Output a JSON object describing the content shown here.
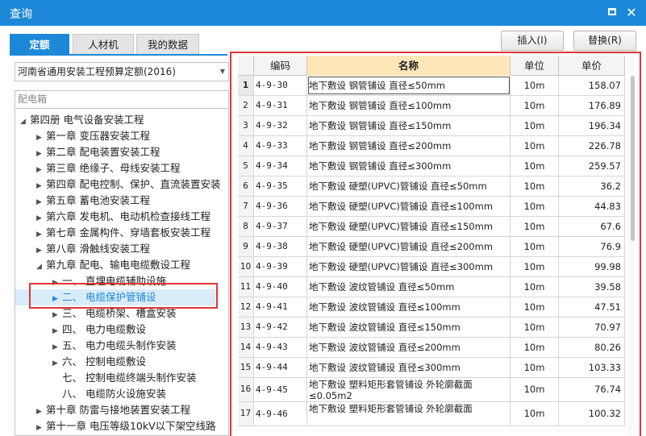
{
  "window": {
    "title": "查询"
  },
  "tabs": [
    {
      "label": "定额"
    },
    {
      "label": "人材机"
    },
    {
      "label": "我的数据"
    }
  ],
  "actions": {
    "insert_label": "插入(I)",
    "replace_label": "替换(R)"
  },
  "library": {
    "selected": "河南省通用安装工程预算定额(2016)"
  },
  "search": {
    "placeholder": "配电箱"
  },
  "tree": [
    {
      "label": "第四册 电气设备安装工程"
    },
    {
      "label": "第一章 变压器安装工程"
    },
    {
      "label": "第二章 配电装置安装工程"
    },
    {
      "label": "第三章 绝缘子、母线安装工程"
    },
    {
      "label": "第四章 配电控制、保护、直流装置安装"
    },
    {
      "label": "第五章 蓄电池安装工程"
    },
    {
      "label": "第六章 发电机、电动机检查接线工程"
    },
    {
      "label": "第七章 金属构件、穿墙套板安装工程"
    },
    {
      "label": "第八章 滑触线安装工程"
    },
    {
      "label": "第九章 配电、输电电缆敷设工程"
    },
    {
      "label": "一、 直埋电缆辅助设施"
    },
    {
      "label": "二、 电缆保护管铺设"
    },
    {
      "label": "三、 电缆桥架、槽盒安装"
    },
    {
      "label": "四、 电力电缆敷设"
    },
    {
      "label": "五、 电力电缆头制作安装"
    },
    {
      "label": "六、 控制电缆敷设"
    },
    {
      "label": "七、 控制电缆终端头制作安装"
    },
    {
      "label": "八、 电缆防火设施安装"
    },
    {
      "label": "第十章 防雷与接地装置安装工程"
    },
    {
      "label": "第十一章 电压等级10kV以下架空线路"
    }
  ],
  "grid": {
    "headers": {
      "code": "编码",
      "name": "名称",
      "unit": "单位",
      "price": "单价"
    },
    "rows": [
      {
        "idx": "1",
        "code": "4-9-30",
        "name": "地下敷设 钢管铺设 直径≤50mm",
        "unit": "10m",
        "price": "158.07"
      },
      {
        "idx": "2",
        "code": "4-9-31",
        "name": "地下敷设 钢管铺设 直径≤100mm",
        "unit": "10m",
        "price": "176.89"
      },
      {
        "idx": "3",
        "code": "4-9-32",
        "name": "地下敷设 钢管铺设 直径≤150mm",
        "unit": "10m",
        "price": "196.34"
      },
      {
        "idx": "4",
        "code": "4-9-33",
        "name": "地下敷设 钢管铺设 直径≤200mm",
        "unit": "10m",
        "price": "226.78"
      },
      {
        "idx": "5",
        "code": "4-9-34",
        "name": "地下敷设 钢管铺设 直径≤300mm",
        "unit": "10m",
        "price": "259.57"
      },
      {
        "idx": "6",
        "code": "4-9-35",
        "name": "地下敷设 硬塑(UPVC)管铺设 直径≤50mm",
        "unit": "10m",
        "price": "36.2"
      },
      {
        "idx": "7",
        "code": "4-9-36",
        "name": "地下敷设 硬塑(UPVC)管铺设 直径≤100mm",
        "unit": "10m",
        "price": "44.83"
      },
      {
        "idx": "8",
        "code": "4-9-37",
        "name": "地下敷设 硬塑(UPVC)管铺设 直径≤150mm",
        "unit": "10m",
        "price": "67.6"
      },
      {
        "idx": "9",
        "code": "4-9-38",
        "name": "地下敷设 硬塑(UPVC)管铺设 直径≤200mm",
        "unit": "10m",
        "price": "76.9"
      },
      {
        "idx": "10",
        "code": "4-9-39",
        "name": "地下敷设 硬塑(UPVC)管铺设 直径≤300mm",
        "unit": "10m",
        "price": "99.98"
      },
      {
        "idx": "11",
        "code": "4-9-40",
        "name": "地下敷设 波纹管铺设 直径≤50mm",
        "unit": "10m",
        "price": "39.58"
      },
      {
        "idx": "12",
        "code": "4-9-41",
        "name": "地下敷设 波纹管铺设 直径≤100mm",
        "unit": "10m",
        "price": "47.51"
      },
      {
        "idx": "13",
        "code": "4-9-42",
        "name": "地下敷设 波纹管铺设 直径≤150mm",
        "unit": "10m",
        "price": "70.97"
      },
      {
        "idx": "14",
        "code": "4-9-43",
        "name": "地下敷设 波纹管铺设 直径≤200mm",
        "unit": "10m",
        "price": "80.26"
      },
      {
        "idx": "15",
        "code": "4-9-44",
        "name": "地下敷设 波纹管铺设 直径≤300mm",
        "unit": "10m",
        "price": "103.33"
      },
      {
        "idx": "16",
        "code": "4-9-45",
        "name": "地下敷设 塑料矩形套管铺设 外轮廓截面≤0.05m2",
        "unit": "10m",
        "price": "76.74"
      },
      {
        "idx": "17",
        "code": "4-9-46",
        "name": "地下敷设 塑料矩形套管铺设 外轮廓截面",
        "unit": "10m",
        "price": "100.32"
      }
    ]
  }
}
